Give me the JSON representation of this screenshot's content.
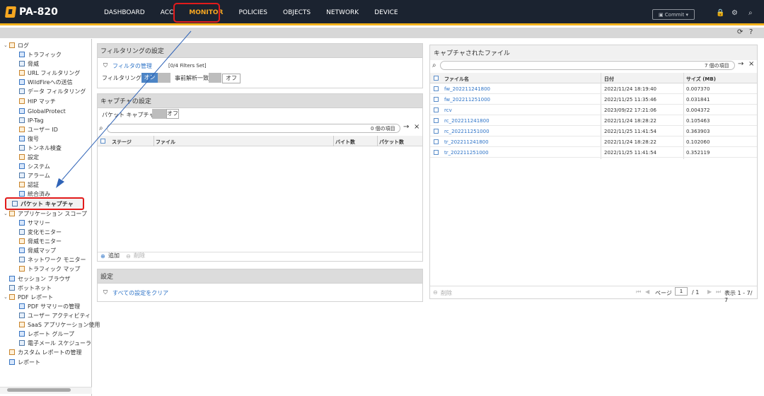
{
  "header": {
    "app_title": "PA-820",
    "commit_label": "Commit",
    "nav": [
      {
        "label": "DASHBOARD"
      },
      {
        "label": "ACC"
      },
      {
        "label": "MONITOR"
      },
      {
        "label": "POLICIES"
      },
      {
        "label": "OBJECTS"
      },
      {
        "label": "NETWORK"
      },
      {
        "label": "DEVICE"
      }
    ]
  },
  "sidebar": [
    {
      "label": "ログ",
      "expanded": true,
      "level": 0,
      "icon": "log-icon"
    },
    {
      "label": "トラフィック",
      "level": 1,
      "icon": "traffic-icon"
    },
    {
      "label": "脅威",
      "level": 1,
      "icon": "threat-icon"
    },
    {
      "label": "URL フィルタリング",
      "level": 1,
      "icon": "url-icon"
    },
    {
      "label": "WildFireへの送信",
      "level": 1,
      "icon": "wildfire-icon"
    },
    {
      "label": "データ フィルタリング",
      "level": 1,
      "icon": "data-filter-icon"
    },
    {
      "label": "HIP マッチ",
      "level": 1,
      "icon": "hip-icon"
    },
    {
      "label": "GlobalProtect",
      "level": 1,
      "icon": "globalprotect-icon"
    },
    {
      "label": "IP-Tag",
      "level": 1,
      "icon": "ip-tag-icon"
    },
    {
      "label": "ユーザー ID",
      "level": 1,
      "icon": "user-id-icon"
    },
    {
      "label": "復号",
      "level": 1,
      "icon": "decrypt-icon"
    },
    {
      "label": "トンネル検査",
      "level": 1,
      "icon": "tunnel-icon"
    },
    {
      "label": "設定",
      "level": 1,
      "icon": "config-icon"
    },
    {
      "label": "システム",
      "level": 1,
      "icon": "system-icon"
    },
    {
      "label": "アラーム",
      "level": 1,
      "icon": "alarm-icon"
    },
    {
      "label": "認証",
      "level": 1,
      "icon": "auth-icon"
    },
    {
      "label": "統合済み",
      "level": 1,
      "icon": "unified-icon"
    },
    {
      "label": "パケット キャプチャ",
      "level": 0,
      "selected": true,
      "icon": "packet-capture-icon"
    },
    {
      "label": "アプリケーション スコープ",
      "expanded": true,
      "level": 0,
      "icon": "app-scope-icon"
    },
    {
      "label": "サマリー",
      "level": 1,
      "icon": "summary-icon"
    },
    {
      "label": "変化モニター",
      "level": 1,
      "icon": "change-monitor-icon"
    },
    {
      "label": "脅威モニター",
      "level": 1,
      "icon": "threat-monitor-icon"
    },
    {
      "label": "脅威マップ",
      "level": 1,
      "icon": "threat-map-icon"
    },
    {
      "label": "ネットワーク モニター",
      "level": 1,
      "icon": "network-monitor-icon"
    },
    {
      "label": "トラフィック マップ",
      "level": 1,
      "icon": "traffic-map-icon"
    },
    {
      "label": "セッション ブラウザ",
      "level": 0,
      "icon": "session-browser-icon"
    },
    {
      "label": "ボットネット",
      "level": 0,
      "icon": "botnet-icon"
    },
    {
      "label": "PDF レポート",
      "expanded": true,
      "level": 0,
      "icon": "pdf-report-icon"
    },
    {
      "label": "PDF サマリーの管理",
      "level": 1,
      "icon": "pdf-summary-icon"
    },
    {
      "label": "ユーザー アクティビティ",
      "level": 1,
      "icon": "user-activity-icon"
    },
    {
      "label": "SaaS アプリケーション使用",
      "level": 1,
      "icon": "saas-icon"
    },
    {
      "label": "レポート グループ",
      "level": 1,
      "icon": "report-group-icon"
    },
    {
      "label": "電子メール スケジューラ",
      "level": 1,
      "icon": "email-scheduler-icon"
    },
    {
      "label": "カスタム レポートの管理",
      "level": 0,
      "icon": "custom-report-icon"
    },
    {
      "label": "レポート",
      "level": 0,
      "icon": "report-icon"
    }
  ],
  "filter_panel": {
    "title": "フィルタリングの設定",
    "manage_link": "フィルタの管理",
    "filters_set": "[0/4 Filters Set]",
    "filtering_label": "フィルタリング",
    "filtering_value": "オン",
    "pre_parse_label": "事前解析一致",
    "pre_parse_value": "オフ"
  },
  "capture_panel": {
    "title": "キャプチャの設定",
    "packet_capture_label": "パケット キャプチャ",
    "packet_capture_value": "オフ",
    "search_count": "0 個の項目",
    "columns": [
      "ステージ",
      "ファイル",
      "バイト数",
      "パケット数"
    ],
    "add_label": "追加",
    "delete_label": "削除"
  },
  "settings_panel": {
    "title": "設定",
    "clear_all": "すべての設定をクリア"
  },
  "files_panel": {
    "title": "キャプチャされたファイル",
    "search_count": "7 個の項目",
    "columns": [
      "ファイル名",
      "日付",
      "サイズ (MB)"
    ],
    "rows": [
      {
        "name": "fw_202211241800",
        "date": "2022/11/24 18:19:40",
        "size": "0.007370"
      },
      {
        "name": "fw_202211251000",
        "date": "2022/11/25 11:35:46",
        "size": "0.031841"
      },
      {
        "name": "rcv",
        "date": "2023/09/22 17:21:06",
        "size": "0.004372"
      },
      {
        "name": "rc_202211241800",
        "date": "2022/11/24 18:28:22",
        "size": "0.105463"
      },
      {
        "name": "rc_202211251000",
        "date": "2022/11/25 11:41:54",
        "size": "0.363903"
      },
      {
        "name": "tr_202211241800",
        "date": "2022/11/24 18:28:22",
        "size": "0.102060"
      },
      {
        "name": "tr_202211251000",
        "date": "2022/11/25 11:41:54",
        "size": "0.352119"
      }
    ],
    "delete_label": "削除",
    "page_label": "ページ",
    "page_value": "1",
    "page_total": "/ 1",
    "display_label": "表示 1 - 7/ 7"
  },
  "colors": {
    "topbar": "#1b2330",
    "accent": "#f3b21b",
    "highlight": "#e21b1b",
    "link": "#2d73c7"
  }
}
